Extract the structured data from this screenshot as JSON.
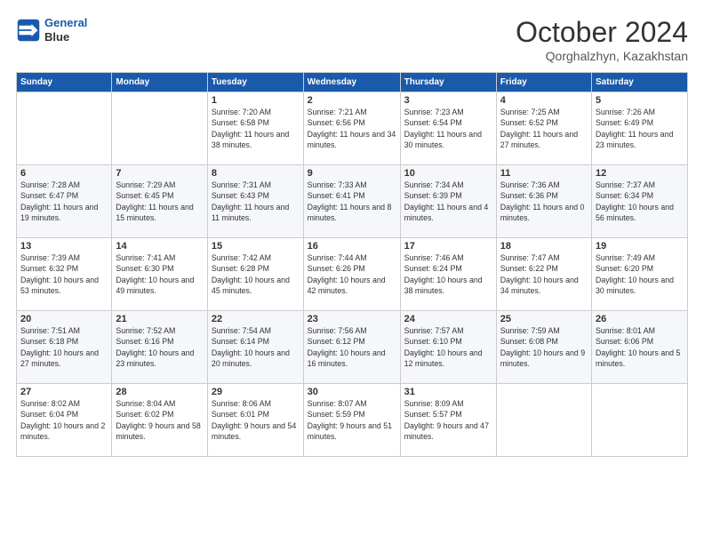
{
  "logo": {
    "line1": "General",
    "line2": "Blue"
  },
  "title": "October 2024",
  "location": "Qorghalzhyn, Kazakhstan",
  "weekdays": [
    "Sunday",
    "Monday",
    "Tuesday",
    "Wednesday",
    "Thursday",
    "Friday",
    "Saturday"
  ],
  "weeks": [
    [
      {
        "day": "",
        "sunrise": "",
        "sunset": "",
        "daylight": ""
      },
      {
        "day": "",
        "sunrise": "",
        "sunset": "",
        "daylight": ""
      },
      {
        "day": "1",
        "sunrise": "Sunrise: 7:20 AM",
        "sunset": "Sunset: 6:58 PM",
        "daylight": "Daylight: 11 hours and 38 minutes."
      },
      {
        "day": "2",
        "sunrise": "Sunrise: 7:21 AM",
        "sunset": "Sunset: 6:56 PM",
        "daylight": "Daylight: 11 hours and 34 minutes."
      },
      {
        "day": "3",
        "sunrise": "Sunrise: 7:23 AM",
        "sunset": "Sunset: 6:54 PM",
        "daylight": "Daylight: 11 hours and 30 minutes."
      },
      {
        "day": "4",
        "sunrise": "Sunrise: 7:25 AM",
        "sunset": "Sunset: 6:52 PM",
        "daylight": "Daylight: 11 hours and 27 minutes."
      },
      {
        "day": "5",
        "sunrise": "Sunrise: 7:26 AM",
        "sunset": "Sunset: 6:49 PM",
        "daylight": "Daylight: 11 hours and 23 minutes."
      }
    ],
    [
      {
        "day": "6",
        "sunrise": "Sunrise: 7:28 AM",
        "sunset": "Sunset: 6:47 PM",
        "daylight": "Daylight: 11 hours and 19 minutes."
      },
      {
        "day": "7",
        "sunrise": "Sunrise: 7:29 AM",
        "sunset": "Sunset: 6:45 PM",
        "daylight": "Daylight: 11 hours and 15 minutes."
      },
      {
        "day": "8",
        "sunrise": "Sunrise: 7:31 AM",
        "sunset": "Sunset: 6:43 PM",
        "daylight": "Daylight: 11 hours and 11 minutes."
      },
      {
        "day": "9",
        "sunrise": "Sunrise: 7:33 AM",
        "sunset": "Sunset: 6:41 PM",
        "daylight": "Daylight: 11 hours and 8 minutes."
      },
      {
        "day": "10",
        "sunrise": "Sunrise: 7:34 AM",
        "sunset": "Sunset: 6:39 PM",
        "daylight": "Daylight: 11 hours and 4 minutes."
      },
      {
        "day": "11",
        "sunrise": "Sunrise: 7:36 AM",
        "sunset": "Sunset: 6:36 PM",
        "daylight": "Daylight: 11 hours and 0 minutes."
      },
      {
        "day": "12",
        "sunrise": "Sunrise: 7:37 AM",
        "sunset": "Sunset: 6:34 PM",
        "daylight": "Daylight: 10 hours and 56 minutes."
      }
    ],
    [
      {
        "day": "13",
        "sunrise": "Sunrise: 7:39 AM",
        "sunset": "Sunset: 6:32 PM",
        "daylight": "Daylight: 10 hours and 53 minutes."
      },
      {
        "day": "14",
        "sunrise": "Sunrise: 7:41 AM",
        "sunset": "Sunset: 6:30 PM",
        "daylight": "Daylight: 10 hours and 49 minutes."
      },
      {
        "day": "15",
        "sunrise": "Sunrise: 7:42 AM",
        "sunset": "Sunset: 6:28 PM",
        "daylight": "Daylight: 10 hours and 45 minutes."
      },
      {
        "day": "16",
        "sunrise": "Sunrise: 7:44 AM",
        "sunset": "Sunset: 6:26 PM",
        "daylight": "Daylight: 10 hours and 42 minutes."
      },
      {
        "day": "17",
        "sunrise": "Sunrise: 7:46 AM",
        "sunset": "Sunset: 6:24 PM",
        "daylight": "Daylight: 10 hours and 38 minutes."
      },
      {
        "day": "18",
        "sunrise": "Sunrise: 7:47 AM",
        "sunset": "Sunset: 6:22 PM",
        "daylight": "Daylight: 10 hours and 34 minutes."
      },
      {
        "day": "19",
        "sunrise": "Sunrise: 7:49 AM",
        "sunset": "Sunset: 6:20 PM",
        "daylight": "Daylight: 10 hours and 30 minutes."
      }
    ],
    [
      {
        "day": "20",
        "sunrise": "Sunrise: 7:51 AM",
        "sunset": "Sunset: 6:18 PM",
        "daylight": "Daylight: 10 hours and 27 minutes."
      },
      {
        "day": "21",
        "sunrise": "Sunrise: 7:52 AM",
        "sunset": "Sunset: 6:16 PM",
        "daylight": "Daylight: 10 hours and 23 minutes."
      },
      {
        "day": "22",
        "sunrise": "Sunrise: 7:54 AM",
        "sunset": "Sunset: 6:14 PM",
        "daylight": "Daylight: 10 hours and 20 minutes."
      },
      {
        "day": "23",
        "sunrise": "Sunrise: 7:56 AM",
        "sunset": "Sunset: 6:12 PM",
        "daylight": "Daylight: 10 hours and 16 minutes."
      },
      {
        "day": "24",
        "sunrise": "Sunrise: 7:57 AM",
        "sunset": "Sunset: 6:10 PM",
        "daylight": "Daylight: 10 hours and 12 minutes."
      },
      {
        "day": "25",
        "sunrise": "Sunrise: 7:59 AM",
        "sunset": "Sunset: 6:08 PM",
        "daylight": "Daylight: 10 hours and 9 minutes."
      },
      {
        "day": "26",
        "sunrise": "Sunrise: 8:01 AM",
        "sunset": "Sunset: 6:06 PM",
        "daylight": "Daylight: 10 hours and 5 minutes."
      }
    ],
    [
      {
        "day": "27",
        "sunrise": "Sunrise: 8:02 AM",
        "sunset": "Sunset: 6:04 PM",
        "daylight": "Daylight: 10 hours and 2 minutes."
      },
      {
        "day": "28",
        "sunrise": "Sunrise: 8:04 AM",
        "sunset": "Sunset: 6:02 PM",
        "daylight": "Daylight: 9 hours and 58 minutes."
      },
      {
        "day": "29",
        "sunrise": "Sunrise: 8:06 AM",
        "sunset": "Sunset: 6:01 PM",
        "daylight": "Daylight: 9 hours and 54 minutes."
      },
      {
        "day": "30",
        "sunrise": "Sunrise: 8:07 AM",
        "sunset": "Sunset: 5:59 PM",
        "daylight": "Daylight: 9 hours and 51 minutes."
      },
      {
        "day": "31",
        "sunrise": "Sunrise: 8:09 AM",
        "sunset": "Sunset: 5:57 PM",
        "daylight": "Daylight: 9 hours and 47 minutes."
      },
      {
        "day": "",
        "sunrise": "",
        "sunset": "",
        "daylight": ""
      },
      {
        "day": "",
        "sunrise": "",
        "sunset": "",
        "daylight": ""
      }
    ]
  ]
}
